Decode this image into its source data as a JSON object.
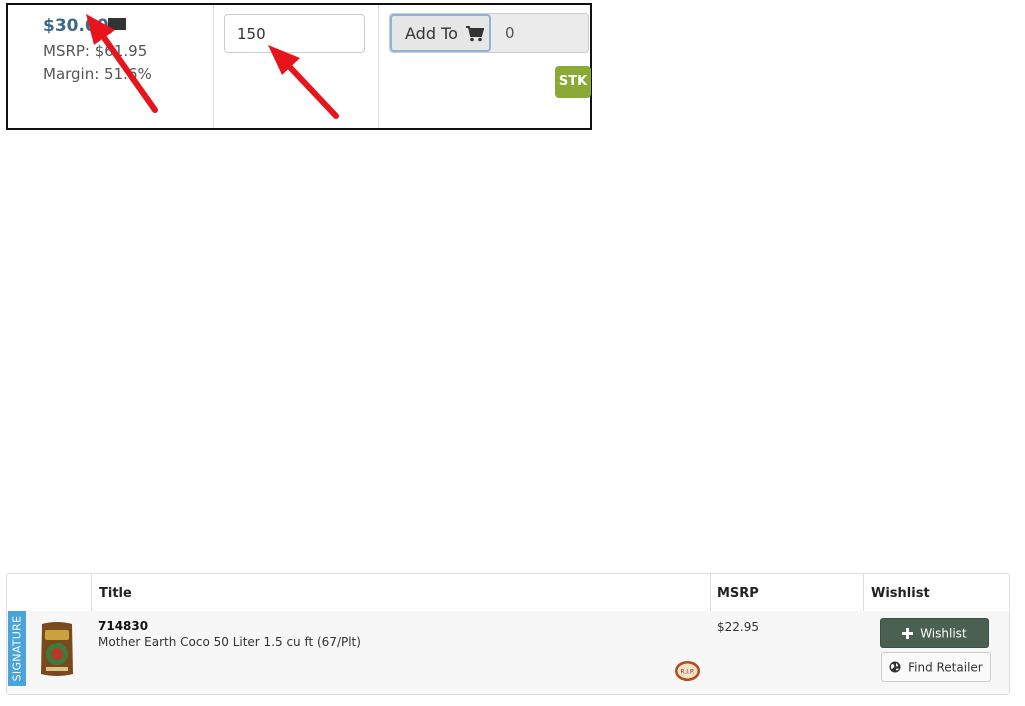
{
  "callout": {
    "price": "$30.00",
    "msrp_text": "MSRP: $61.95",
    "margin_text": "Margin: 51.6%",
    "quantity_value": "150",
    "add_to_label": "Add To",
    "cart_count": "0",
    "stock_badge": "STK"
  },
  "table": {
    "headers": {
      "title": "Title",
      "msrp": "MSRP",
      "wishlist": "Wishlist"
    },
    "row": {
      "ribbon": "SIGNATURE",
      "sku": "714830",
      "title": "Mother Earth Coco 50 Liter 1.5 cu ft (67/Plt)",
      "msrp": "$22.95",
      "wishlist_button": "Wishlist",
      "find_retailer_button": "Find Retailer",
      "badge_text": "R.I.P."
    }
  },
  "colors": {
    "price_link": "#3d6a8c",
    "stock_badge": "#8aaa35",
    "signature_ribbon": "#4aa3d9",
    "wishlist_button": "#4a6152",
    "annotation_arrow": "#e8141b"
  },
  "icons": {
    "comment": "comment-icon",
    "cart": "cart-icon",
    "plus": "plus-icon",
    "globe": "globe-icon"
  }
}
